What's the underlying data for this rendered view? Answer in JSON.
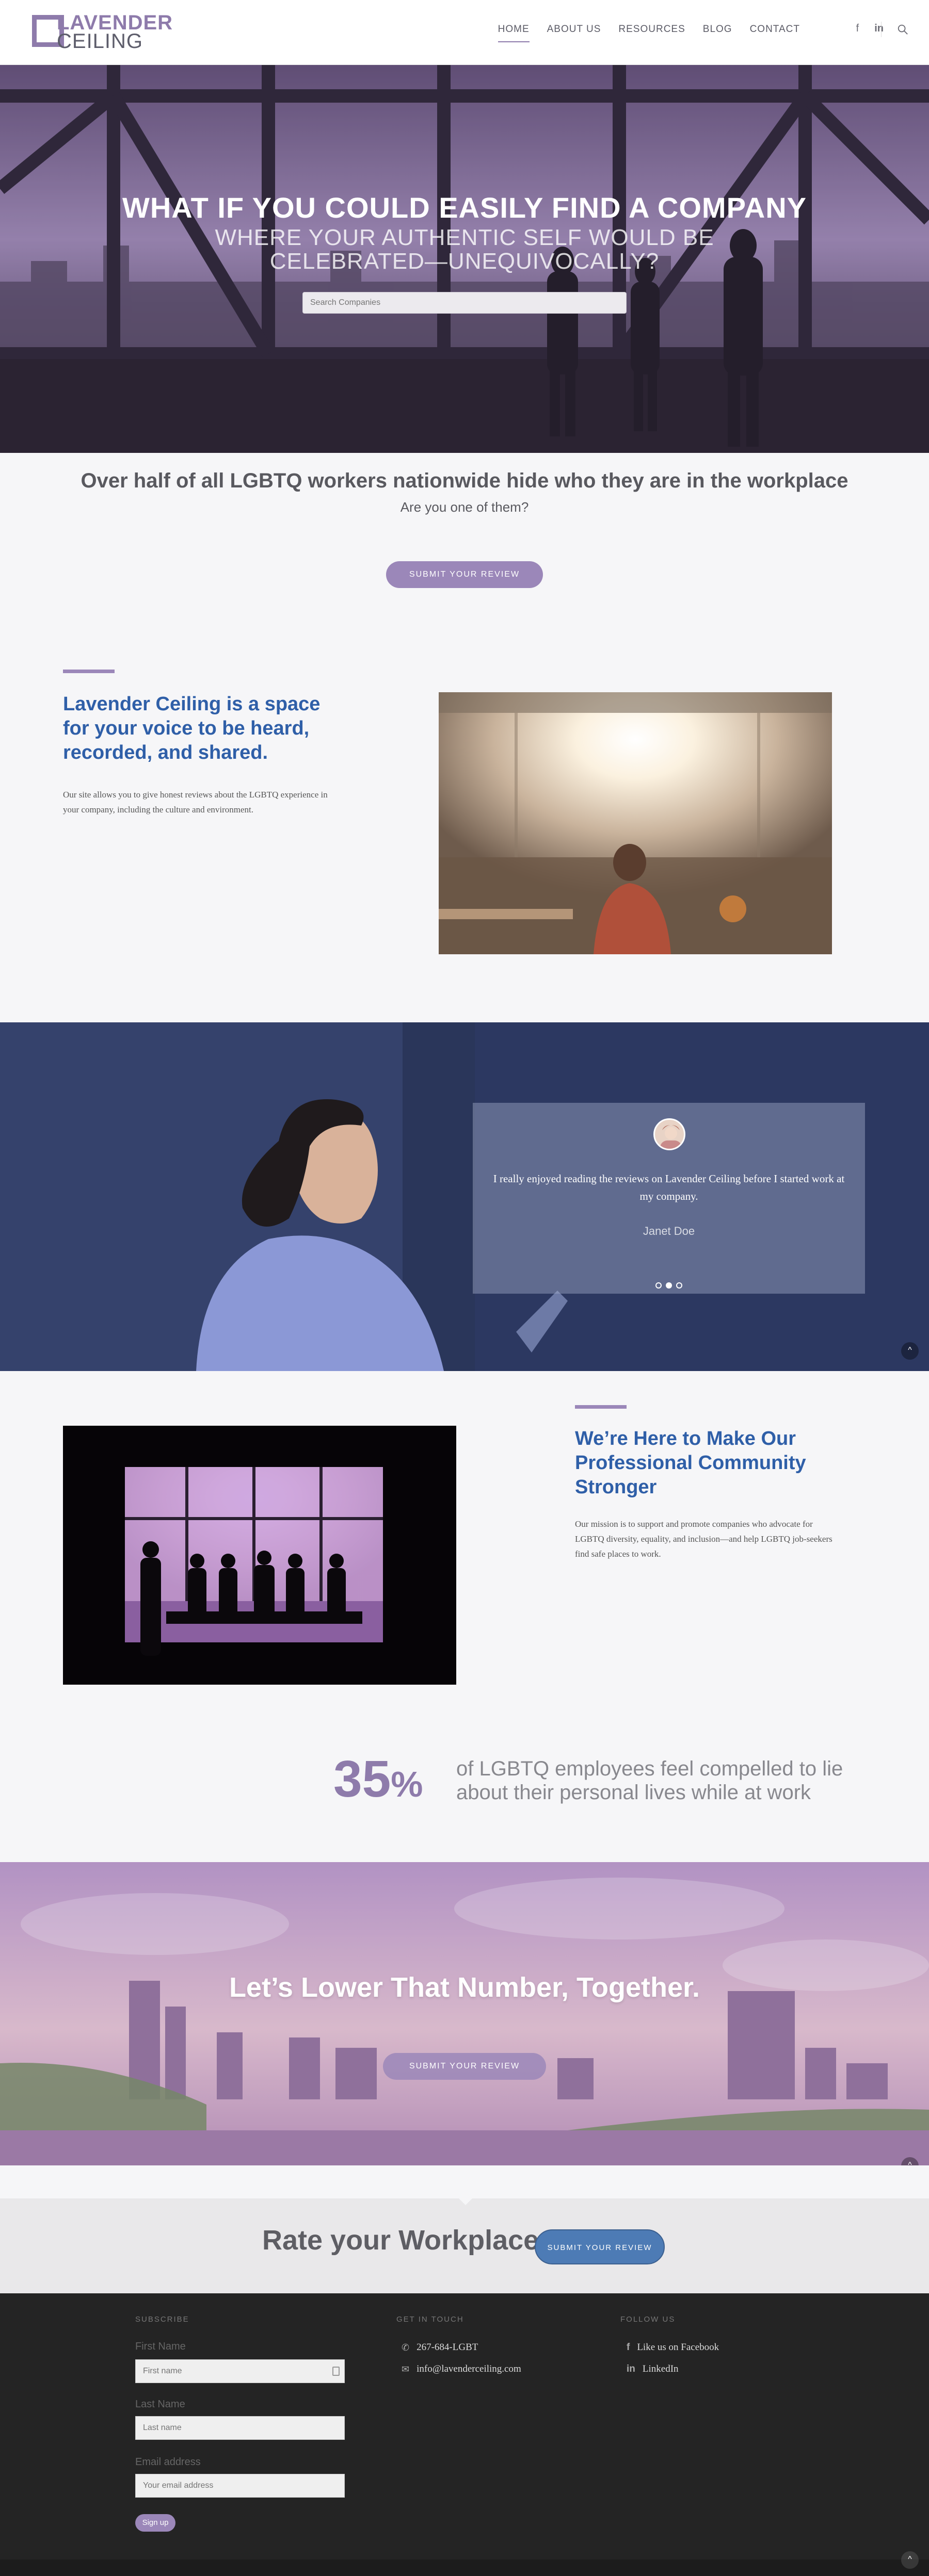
{
  "header": {
    "logo_line1": "LAVENDER",
    "logo_line2": "CEILING",
    "nav": [
      "HOME",
      "ABOUT US",
      "RESOURCES",
      "BLOG",
      "CONTACT"
    ],
    "social": [
      "f",
      "in"
    ]
  },
  "hero": {
    "title": "WHAT IF YOU COULD EASILY FIND A COMPANY",
    "subtitle": "WHERE YOUR AUTHENTIC SELF WOULD BE CELEBRATED—UNEQUIVOCALLY?",
    "search_placeholder": "Search Companies"
  },
  "intro": {
    "heading": "Over half of all LGBTQ workers nationwide hide who they are in the workplace",
    "subheading": "Are you one of them?",
    "button": "SUBMIT YOUR REVIEW"
  },
  "about": {
    "heading": "Lavender Ceiling is a space for your voice to be heard, recorded, and shared.",
    "body": "Our site allows you to give honest reviews about the LGBTQ experience in your company, including the culture and environment."
  },
  "testimonial": {
    "quote": "I really enjoyed reading the reviews on Lavender Ceiling before I started work at my company.",
    "name": "Janet Doe",
    "active_slide": 2,
    "slides": 3
  },
  "mission": {
    "heading": "We’re Here to Make Our Professional Community Stronger",
    "body": "Our mission is to support and promote companies who advocate for LGBTQ diversity, equality, and inclusion—and help LGBTQ job-seekers find safe places to work."
  },
  "stat": {
    "number": "35",
    "unit": "%",
    "text": "of LGBTQ employees feel compelled to lie about their personal lives while at work"
  },
  "city": {
    "title": "Let’s Lower That Number, Together.",
    "button": "SUBMIT YOUR REVIEW"
  },
  "rate": {
    "title": "Rate your Workplace",
    "button": "SUBMIT YOUR REVIEW"
  },
  "footer": {
    "subscribe_title": "SUBSCRIBE",
    "first_name_label": "First Name",
    "first_name_placeholder": "First name",
    "last_name_label": "Last Name",
    "last_name_placeholder": "Last name",
    "email_label": "Email address",
    "email_placeholder": "Your email address",
    "signup": "Sign up",
    "contact_title": "GET IN TOUCH",
    "phone": "267-684-LGBT",
    "email": "info@lavenderceiling.com",
    "follow_title": "FOLLOW US",
    "facebook": "Like us on Facebook",
    "linkedin": "LinkedIn"
  },
  "colors": {
    "accent": "#9b87b9",
    "heading_blue": "#2f5fa8",
    "footer_bg": "#242424"
  }
}
